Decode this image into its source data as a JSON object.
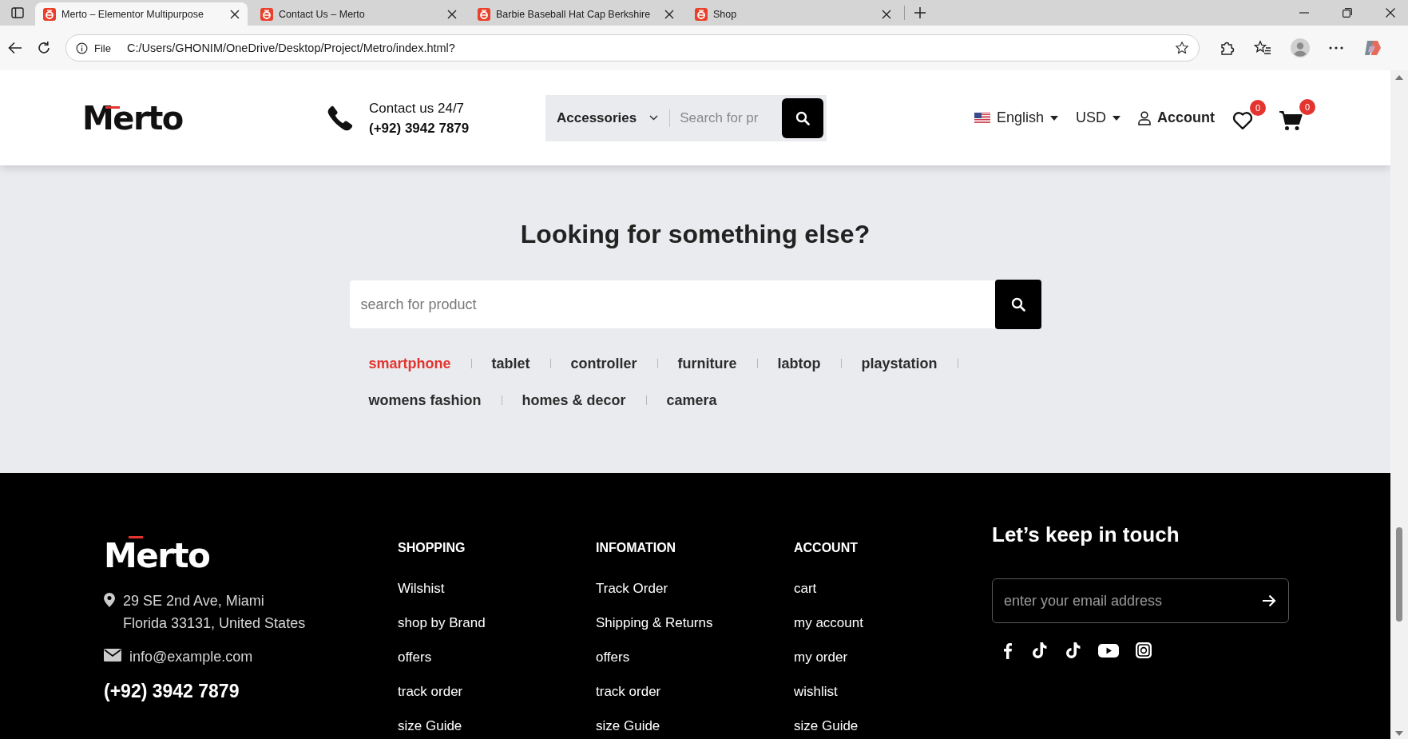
{
  "browser": {
    "tabs": [
      {
        "title": "Merto – Elementor Multipurpose",
        "selected": true
      },
      {
        "title": "Contact Us – Merto",
        "selected": false
      },
      {
        "title": "Barbie Baseball Hat Cap Berkshire",
        "selected": false
      },
      {
        "title": "Shop",
        "selected": false
      }
    ],
    "address": {
      "scheme": "File",
      "url": "C:/Users/GHONIM/OneDrive/Desktop/Project/Metro/index.html?"
    }
  },
  "header": {
    "logo": "Merto",
    "contact": {
      "label": "Contact us 24/7",
      "phone": "(+92) 3942 7879"
    },
    "search": {
      "category": "Accessories",
      "placeholder": "Search for pr"
    },
    "language": "English",
    "currency": "USD",
    "account": "Account",
    "wishlist_count": "0",
    "cart_count": "0"
  },
  "search_section": {
    "heading": "Looking for something else?",
    "placeholder": "search for product",
    "tags": [
      {
        "label": "smartphone",
        "selected": true
      },
      {
        "label": "tablet",
        "selected": false
      },
      {
        "label": "controller",
        "selected": false
      },
      {
        "label": "furniture",
        "selected": false
      },
      {
        "label": "labtop",
        "selected": false
      },
      {
        "label": "playstation",
        "selected": false
      },
      {
        "label": "womens fashion",
        "selected": false
      },
      {
        "label": "homes & decor",
        "selected": false
      },
      {
        "label": "camera",
        "selected": false
      }
    ]
  },
  "footer": {
    "logo": "Merto",
    "address": [
      "29 SE 2nd Ave, Miami",
      "Florida 33131, United States"
    ],
    "email": "info@example.com",
    "phone": "(+92) 3942 7879",
    "columns": [
      {
        "title": "SHOPPING",
        "links": [
          "Wilshist",
          "shop by Brand",
          "offers",
          "track order",
          "size Guide"
        ]
      },
      {
        "title": "INFOMATION",
        "links": [
          "Track Order",
          "Shipping & Returns",
          "offers",
          "track order",
          "size Guide"
        ]
      },
      {
        "title": "ACCOUNT",
        "links": [
          "cart",
          "my account",
          "my order",
          "wishlist",
          "size Guide"
        ]
      }
    ],
    "newsletter": {
      "title": "Let’s keep in touch",
      "placeholder": "enter your email address"
    }
  }
}
